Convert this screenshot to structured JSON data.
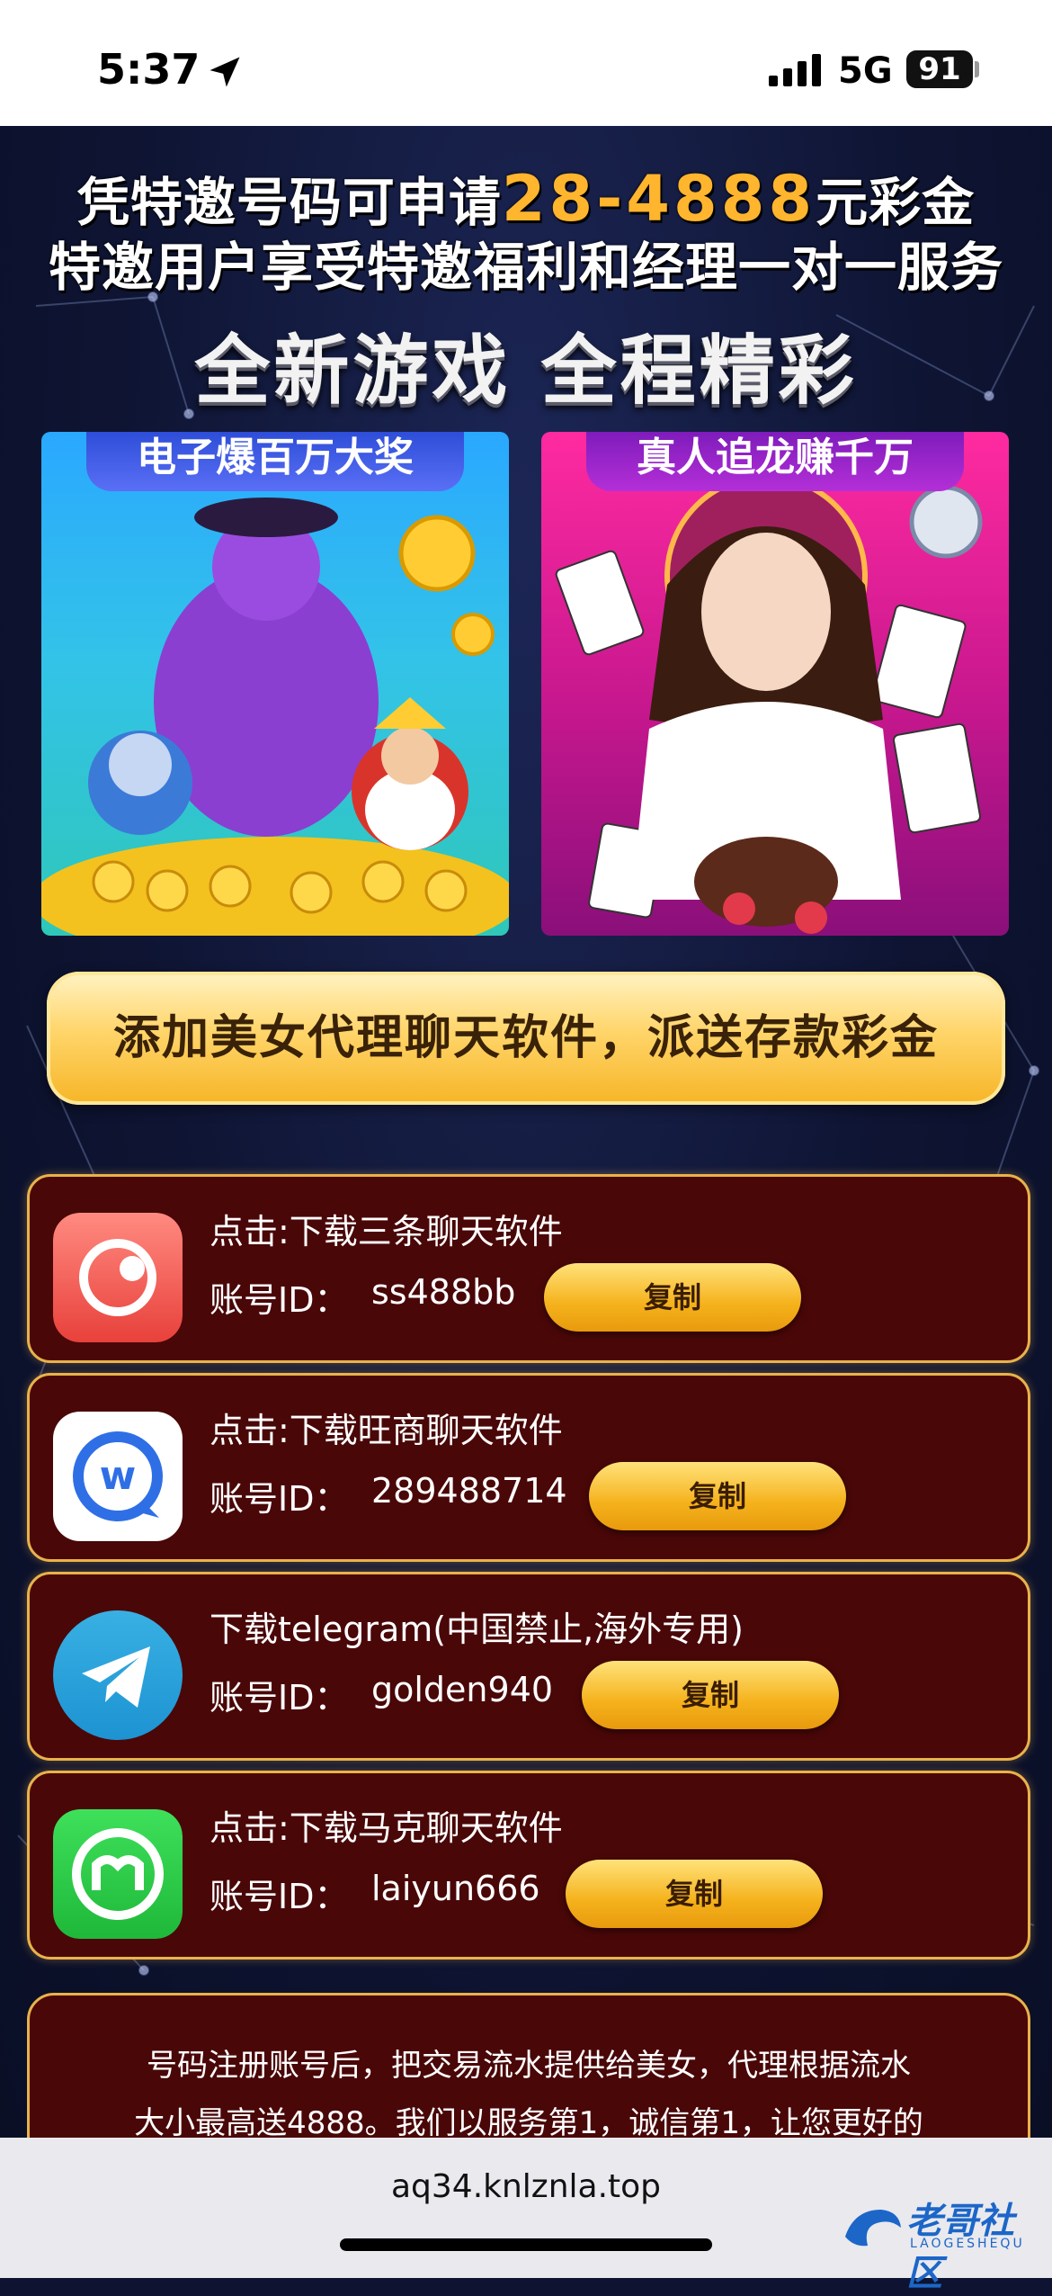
{
  "status_bar": {
    "time": "5:37",
    "network": "5G",
    "battery": "91"
  },
  "headline": {
    "line1_prefix": "凭特邀号码可申请",
    "line1_amount": "28-4888",
    "line1_suffix": "元彩金",
    "line2": "特邀用户享受特邀福利和经理一对一服务"
  },
  "subhead": "全新游戏 全程精彩",
  "cards": [
    {
      "title": "电子爆百万大奖"
    },
    {
      "title": "真人追龙赚千万"
    }
  ],
  "banner": "添加美女代理聊天软件，派送存款彩金",
  "apps": [
    {
      "title": "点击:下载三条聊天软件",
      "id_label": "账号ID：",
      "id": "ss488bb",
      "copy": "复制",
      "icon": "sanjiao-chat-icon"
    },
    {
      "title": "点击:下载旺商聊天软件",
      "id_label": "账号ID：",
      "id": "289488714",
      "copy": "复制",
      "icon": "wangshang-chat-icon"
    },
    {
      "title": "下载telegram(中国禁止,海外专用)",
      "id_label": "账号ID：",
      "id": "golden940",
      "copy": "复制",
      "icon": "telegram-icon"
    },
    {
      "title": "点击:下载马克聊天软件",
      "id_label": "账号ID：",
      "id": "laiyun666",
      "copy": "复制",
      "icon": "make-chat-icon"
    }
  ],
  "info": {
    "line1": "号码注册账号后，把交易流水提供给美女，代理根据流水",
    "line2": "大小最高送4888。我们以服务第1，诚信第1，让您更好的"
  },
  "browser": {
    "url": "aq34.knlznla.top"
  },
  "watermark": {
    "text": "老哥社区",
    "sub": "LAOGESHEQU"
  }
}
